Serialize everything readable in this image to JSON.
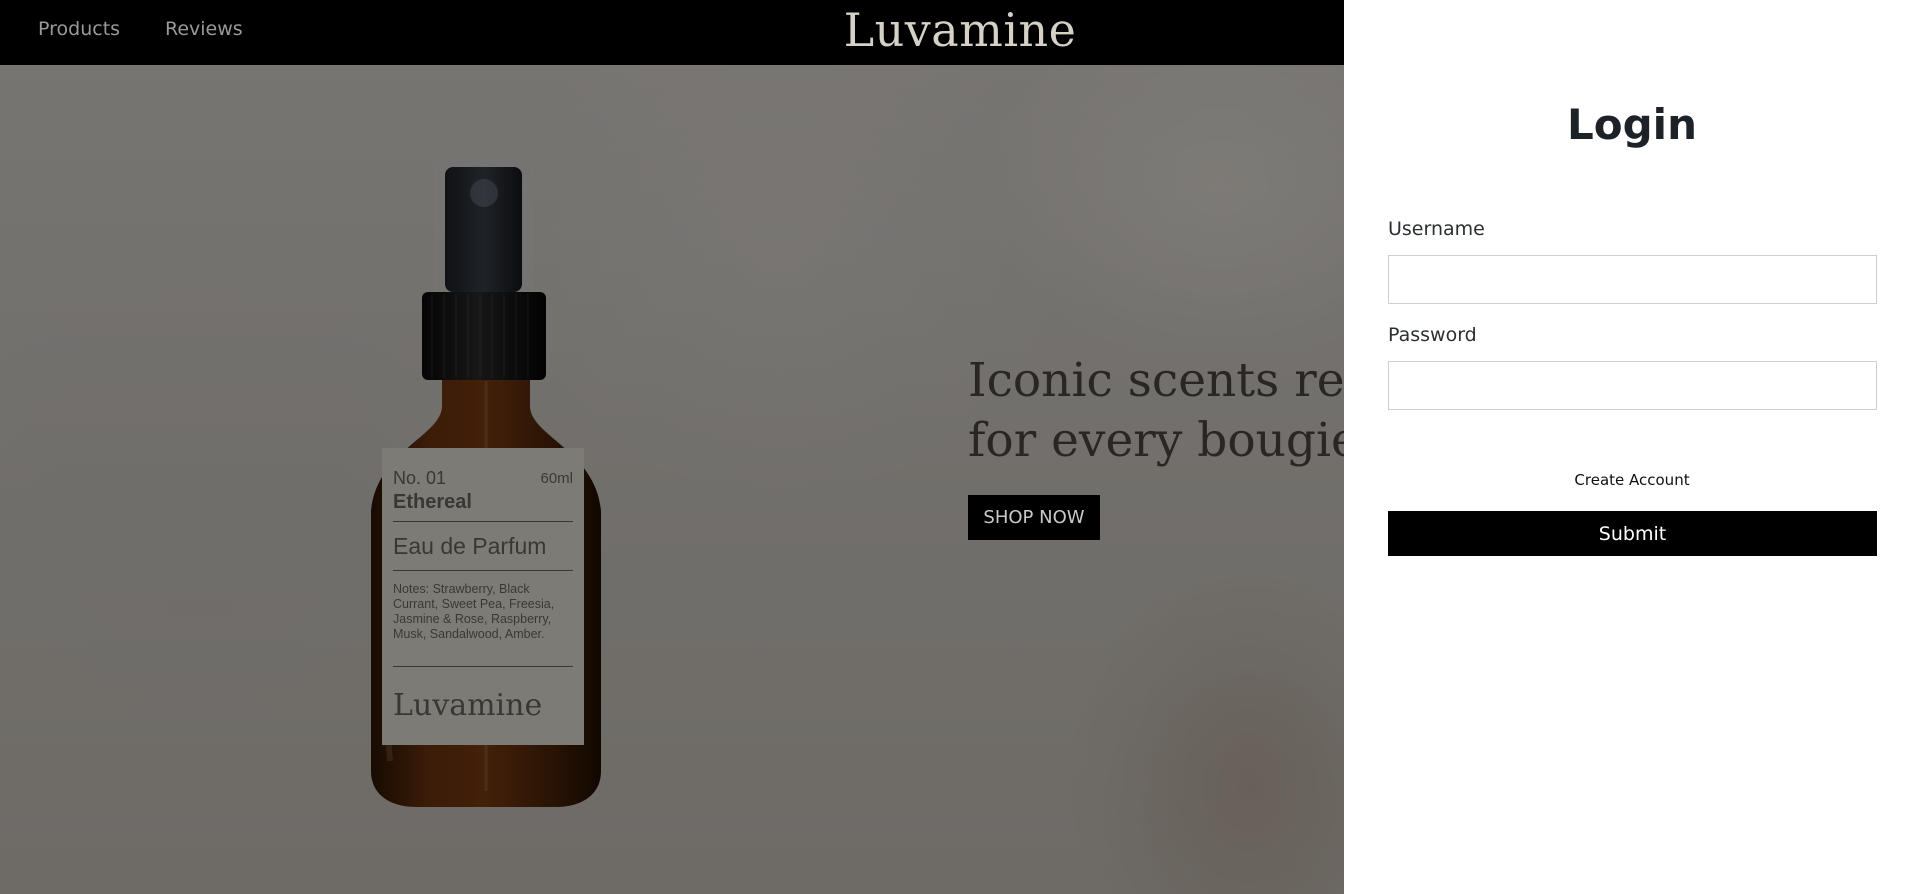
{
  "navbar": {
    "links": [
      "Products",
      "Reviews"
    ],
    "brand": "Luvamine"
  },
  "hero": {
    "tagline_line1": "Iconic scents ren",
    "tagline_line2": "for every bougie",
    "cta_label": "SHOP NOW",
    "product_label": {
      "number": "No. 01",
      "size": "60ml",
      "name": "Ethereal",
      "type": "Eau de Parfum",
      "notes": "Notes: Strawberry, Black Currant, Sweet Pea, Freesia, Jasmine & Rose, Raspberry, Musk, Sandalwood, Amber.",
      "brand": "Luvamine"
    }
  },
  "login": {
    "title": "Login",
    "username_label": "Username",
    "username_value": "",
    "password_label": "Password",
    "password_value": "",
    "create_account": "Create Account",
    "submit_label": "Submit"
  },
  "colors": {
    "navbar_bg": "#000000",
    "brand_logo": "#d6d1c7",
    "nav_link": "#9a9a9a",
    "button_bg": "#000000",
    "panel_bg": "#ffffff"
  }
}
